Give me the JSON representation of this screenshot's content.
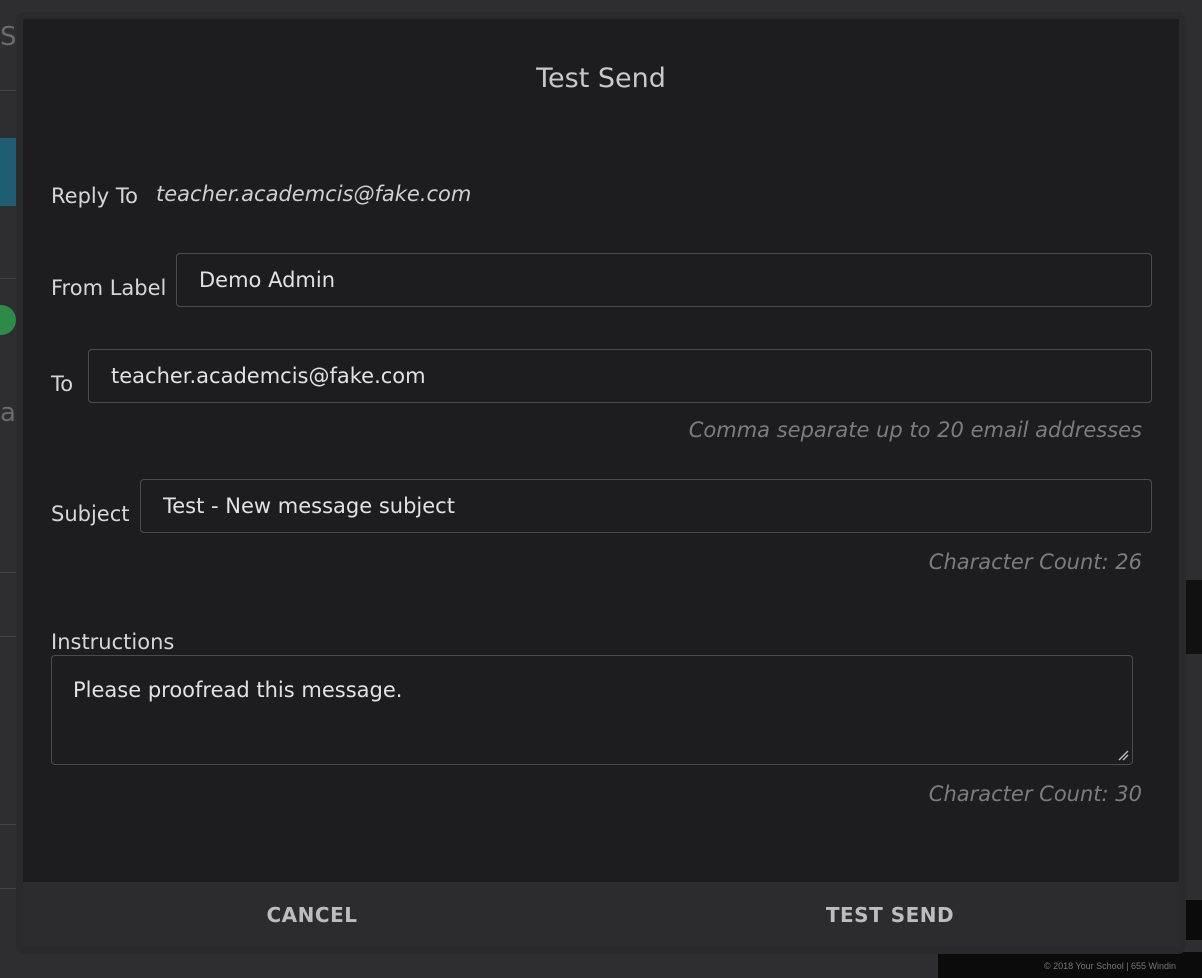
{
  "modal": {
    "title": "Test Send",
    "reply_to": {
      "label": "Reply To",
      "value": "teacher.academcis@fake.com"
    },
    "from_label": {
      "label": "From Label",
      "value": "Demo Admin"
    },
    "to": {
      "label": "To",
      "value": "teacher.academcis@fake.com",
      "hint": "Comma separate up to 20 email addresses"
    },
    "subject": {
      "label": "Subject",
      "value": "Test - New message subject",
      "hint": "Character Count: 26"
    },
    "instructions": {
      "label": "Instructions",
      "value": "Please proofread this message.",
      "hint": "Character Count: 30"
    },
    "buttons": {
      "cancel": "CANCEL",
      "test_send": "TEST SEND"
    }
  },
  "background": {
    "footer_text": "© 2018   Your School  |  655 Windin"
  }
}
